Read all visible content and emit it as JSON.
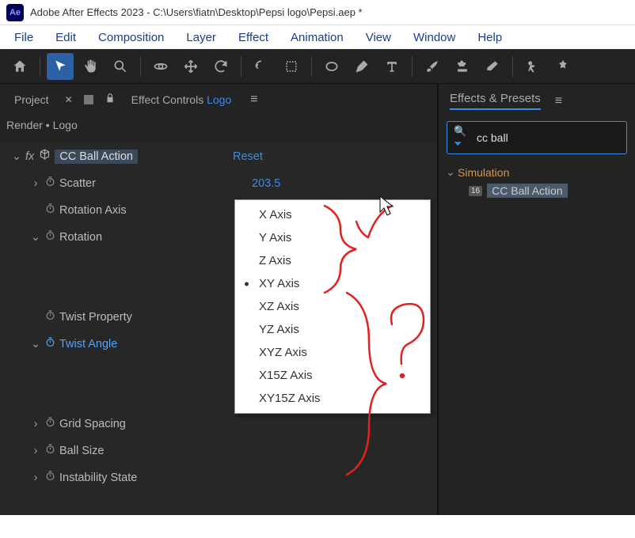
{
  "window": {
    "title": "Adobe After Effects 2023 - C:\\Users\\fiatn\\Desktop\\Pepsi logo\\Pepsi.aep *",
    "logo_text": "Ae"
  },
  "menu": {
    "items": [
      "File",
      "Edit",
      "Composition",
      "Layer",
      "Effect",
      "Animation",
      "View",
      "Window",
      "Help"
    ]
  },
  "left_panel": {
    "tab_project": "Project",
    "tab_fxcontrols_prefix": "Effect Controls",
    "tab_fxcontrols_layer": "Logo",
    "breadcrumb": "Render • Logo"
  },
  "effect": {
    "name": "CC Ball Action",
    "reset": "Reset",
    "rows": {
      "scatter": {
        "label": "Scatter",
        "value": "203.5"
      },
      "rotation_axis": {
        "label": "Rotation Axis",
        "value": "XY Axis"
      },
      "rotation": {
        "label": "Rotation"
      },
      "twist_property": {
        "label": "Twist Property"
      },
      "twist_angle": {
        "label": "Twist Angle"
      },
      "grid_spacing": {
        "label": "Grid Spacing"
      },
      "ball_size": {
        "label": "Ball Size"
      },
      "instability_state": {
        "label": "Instability State"
      }
    }
  },
  "dropdown": {
    "items": [
      "X Axis",
      "Y Axis",
      "Z Axis",
      "XY Axis",
      "XZ Axis",
      "YZ Axis",
      "XYZ Axis",
      "X15Z Axis",
      "XY15Z Axis"
    ],
    "selected_index": 3
  },
  "right_panel": {
    "title": "Effects & Presets",
    "search_value": "cc ball",
    "category": "Simulation",
    "badge": "16",
    "result": "CC Ball Action"
  }
}
